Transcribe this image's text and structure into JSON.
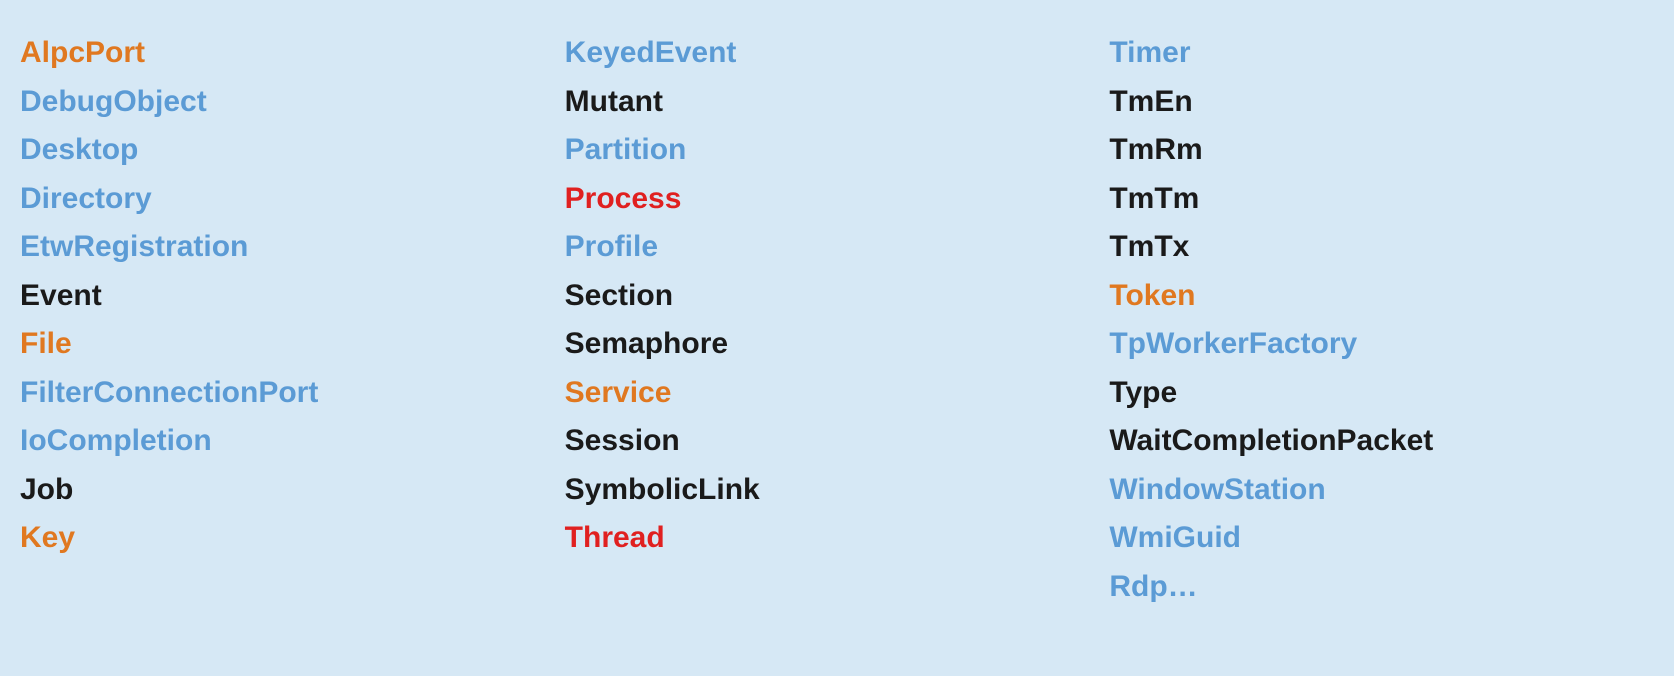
{
  "columns": [
    {
      "id": "col1",
      "items": [
        {
          "label": "AlpcPort",
          "color": "orange"
        },
        {
          "label": "DebugObject",
          "color": "blue"
        },
        {
          "label": "Desktop",
          "color": "blue"
        },
        {
          "label": "Directory",
          "color": "blue"
        },
        {
          "label": "EtwRegistration",
          "color": "blue"
        },
        {
          "label": "Event",
          "color": "black"
        },
        {
          "label": "File",
          "color": "orange"
        },
        {
          "label": "FilterConnectionPort",
          "color": "blue"
        },
        {
          "label": "IoCompletion",
          "color": "blue"
        },
        {
          "label": "Job",
          "color": "black"
        },
        {
          "label": "Key",
          "color": "orange"
        }
      ]
    },
    {
      "id": "col2",
      "items": [
        {
          "label": "KeyedEvent",
          "color": "blue"
        },
        {
          "label": "Mutant",
          "color": "black"
        },
        {
          "label": "Partition",
          "color": "blue"
        },
        {
          "label": "Process",
          "color": "red"
        },
        {
          "label": "Profile",
          "color": "blue"
        },
        {
          "label": "Section",
          "color": "black"
        },
        {
          "label": "Semaphore",
          "color": "black"
        },
        {
          "label": "Service",
          "color": "orange"
        },
        {
          "label": "Session",
          "color": "black"
        },
        {
          "label": "SymbolicLink",
          "color": "black"
        },
        {
          "label": "Thread",
          "color": "red"
        }
      ]
    },
    {
      "id": "col3",
      "items": [
        {
          "label": "Timer",
          "color": "blue"
        },
        {
          "label": "TmEn",
          "color": "black"
        },
        {
          "label": "TmRm",
          "color": "black"
        },
        {
          "label": "TmTm",
          "color": "black"
        },
        {
          "label": "TmTx",
          "color": "black"
        },
        {
          "label": "Token",
          "color": "orange"
        },
        {
          "label": "TpWorkerFactory",
          "color": "blue"
        },
        {
          "label": "Type",
          "color": "black"
        },
        {
          "label": "WaitCompletionPacket",
          "color": "black"
        },
        {
          "label": "WindowStation",
          "color": "blue"
        },
        {
          "label": "WmiGuid",
          "color": "blue"
        },
        {
          "label": "Rdp…",
          "color": "blue"
        }
      ]
    }
  ],
  "colors": {
    "orange": "#E07820",
    "blue": "#5B9BD5",
    "black": "#1a1a1a",
    "red": "#E02020"
  }
}
